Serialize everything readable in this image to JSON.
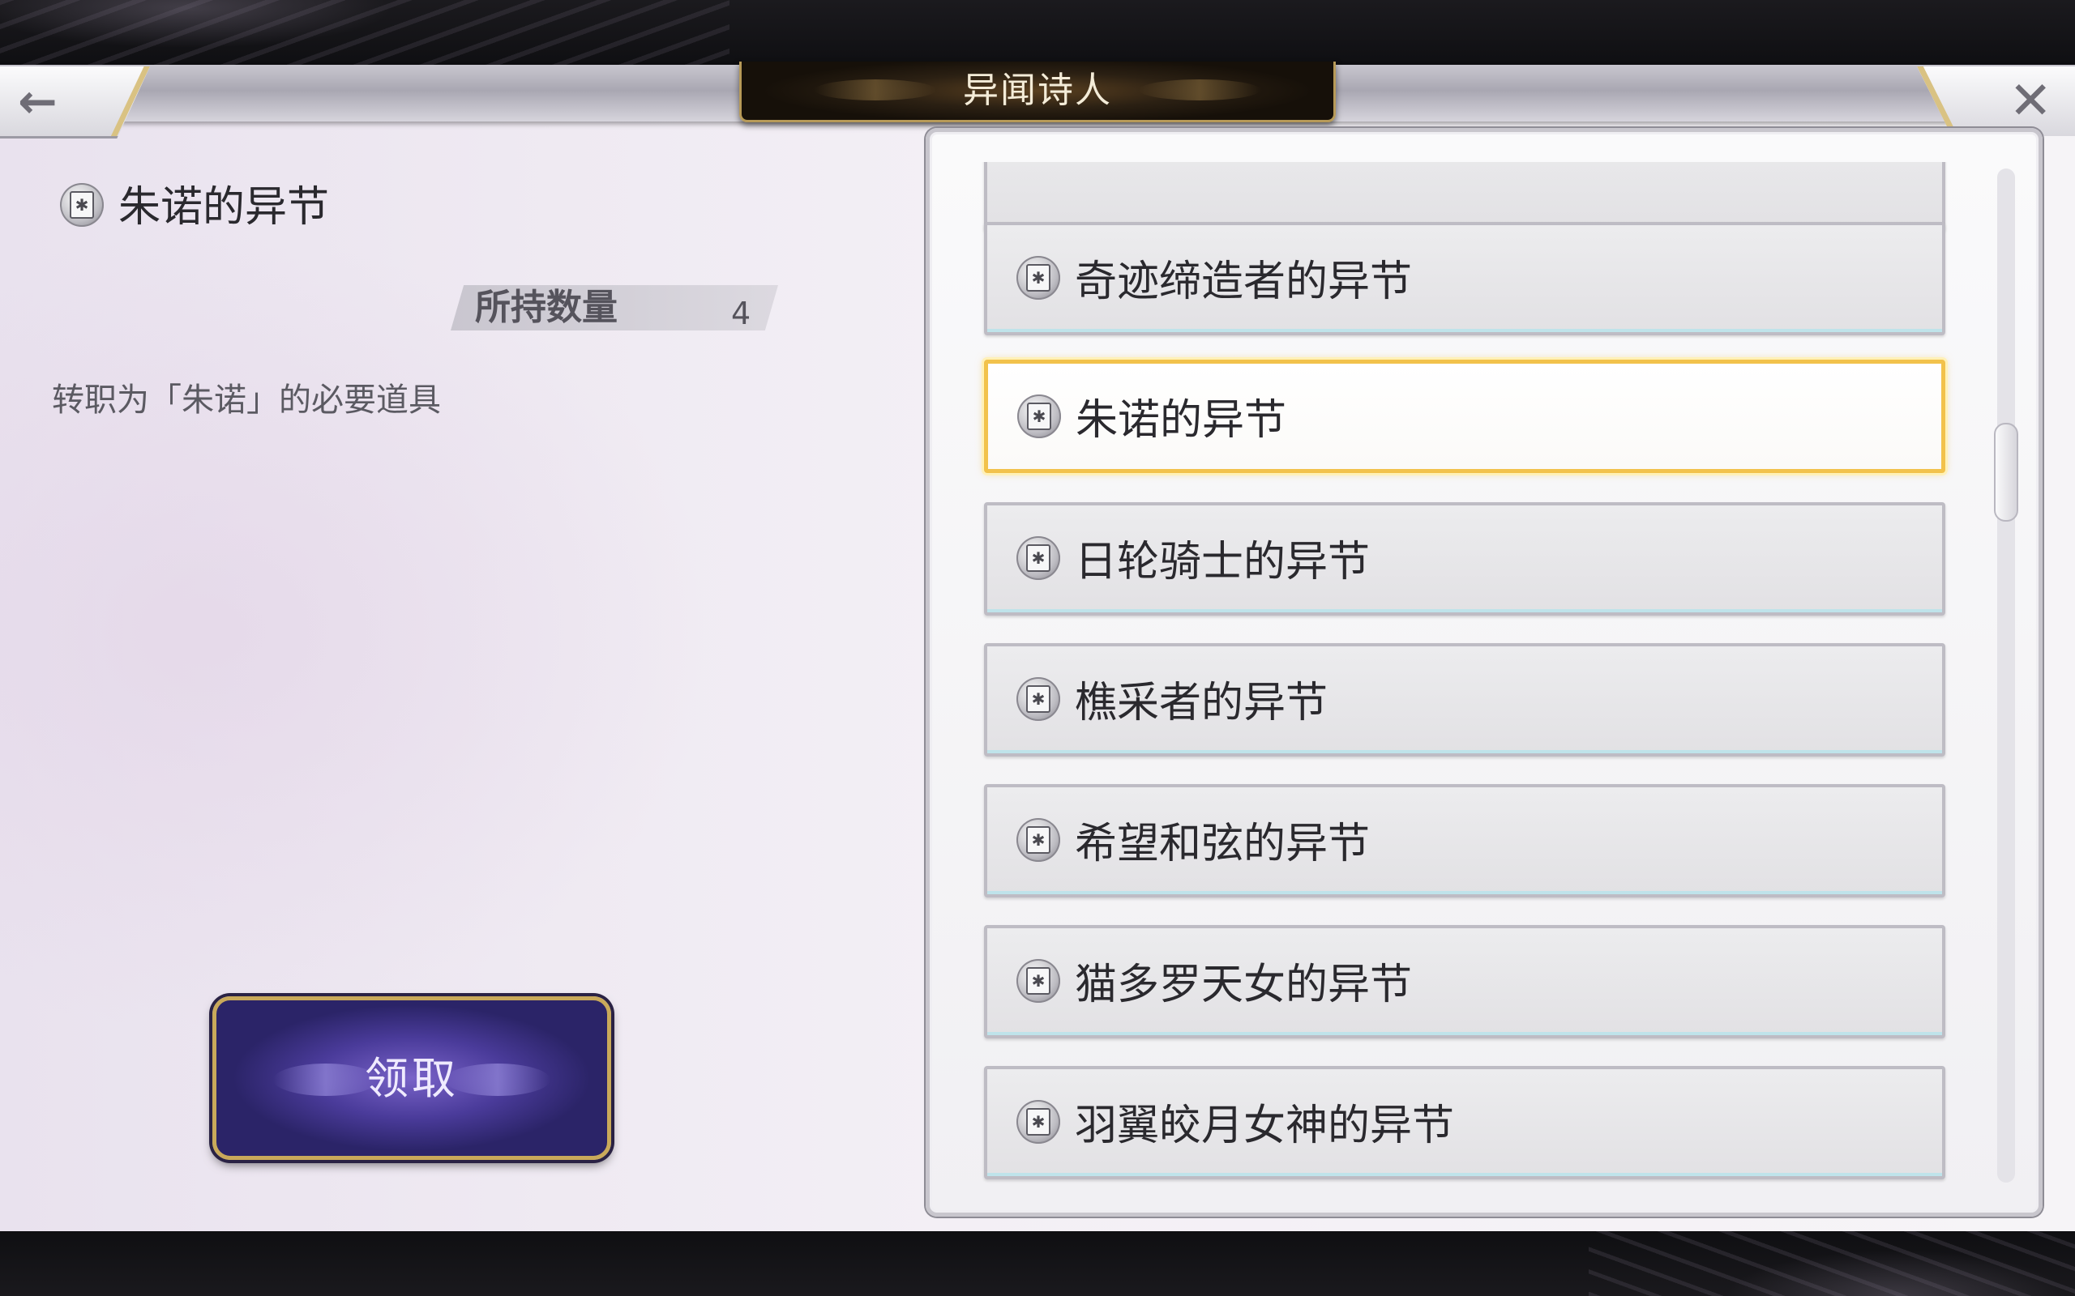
{
  "header": {
    "title": "异闻诗人",
    "back_icon": "←",
    "close_icon": "✕"
  },
  "detail": {
    "item_name": "朱诺的异节",
    "quantity_label": "所持数量",
    "quantity_value": "4",
    "description": "转职为「朱诺」的必要道具",
    "claim_label": "领取"
  },
  "list": {
    "items": [
      {
        "label": ""
      },
      {
        "label": "奇迹缔造者的异节"
      },
      {
        "label": "朱诺的异节"
      },
      {
        "label": "日轮骑士的异节"
      },
      {
        "label": "樵采者的异节"
      },
      {
        "label": "希望和弦的异节"
      },
      {
        "label": "猫多罗天女的异节"
      },
      {
        "label": "羽翼皎月女神的异节"
      }
    ],
    "selected_index": 2,
    "scroll_position": 0.3
  },
  "colors": {
    "selection_border": "#f2c24c",
    "button_purple": "#4a3b9a",
    "gold_trim": "#c9a95a"
  }
}
